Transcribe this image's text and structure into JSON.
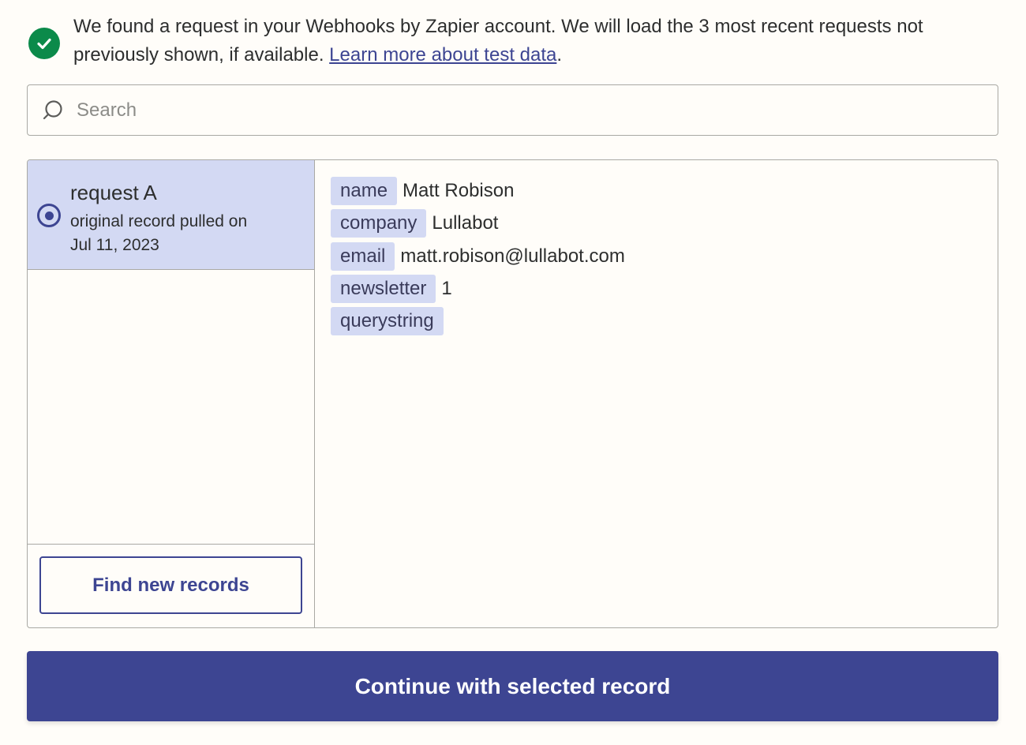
{
  "notice": {
    "text": "We found a request in your Webhooks by Zapier account. We will load the 3 most recent requests not previously shown, if available.",
    "link_text": "Learn more about test data",
    "trailing": ".",
    "icon": "check-circle-icon"
  },
  "search": {
    "placeholder": "Search",
    "value": "",
    "icon": "search-icon"
  },
  "records": [
    {
      "title": "request A",
      "subtitle_line1": "original record pulled on",
      "subtitle_line2": "Jul 11, 2023",
      "selected": true
    }
  ],
  "find_button_label": "Find new records",
  "fields": [
    {
      "key": "name",
      "value": "Matt Robison"
    },
    {
      "key": "company",
      "value": "Lullabot"
    },
    {
      "key": "email",
      "value": "matt.robison@lullabot.com"
    },
    {
      "key": "newsletter",
      "value": "1"
    },
    {
      "key": "querystring",
      "value": ""
    }
  ],
  "continue_button_label": "Continue with selected record",
  "colors": {
    "accent": "#3d4592",
    "selected_bg": "#d3d9f3",
    "success": "#0b8a4a",
    "background": "#fffdf9"
  }
}
